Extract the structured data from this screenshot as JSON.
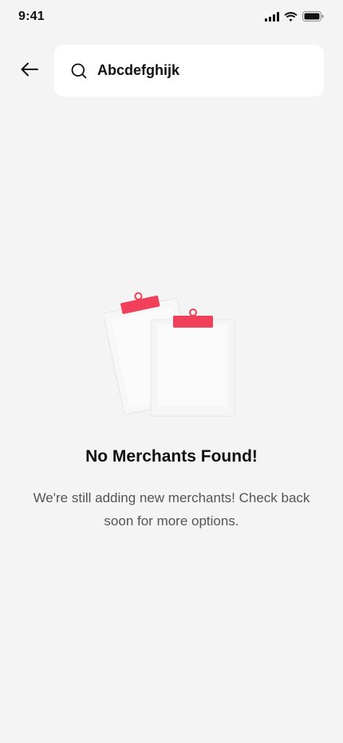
{
  "status_bar": {
    "time": "9:41",
    "icons": [
      "cellular-signal-icon",
      "wifi-icon",
      "battery-icon"
    ]
  },
  "header": {
    "back_icon": "arrow-left-icon",
    "search": {
      "icon": "search-icon",
      "value": "Abcdefghijk",
      "placeholder": ""
    }
  },
  "empty_state": {
    "illustration": "clipboards-illustration",
    "title": "No Merchants Found!",
    "message": "We're still adding new merchants! Check back soon for more options."
  },
  "colors": {
    "background": "#f4f4f4",
    "surface": "#ffffff",
    "accent": "#f0405a",
    "text_primary": "#111111",
    "text_secondary": "#555555"
  }
}
